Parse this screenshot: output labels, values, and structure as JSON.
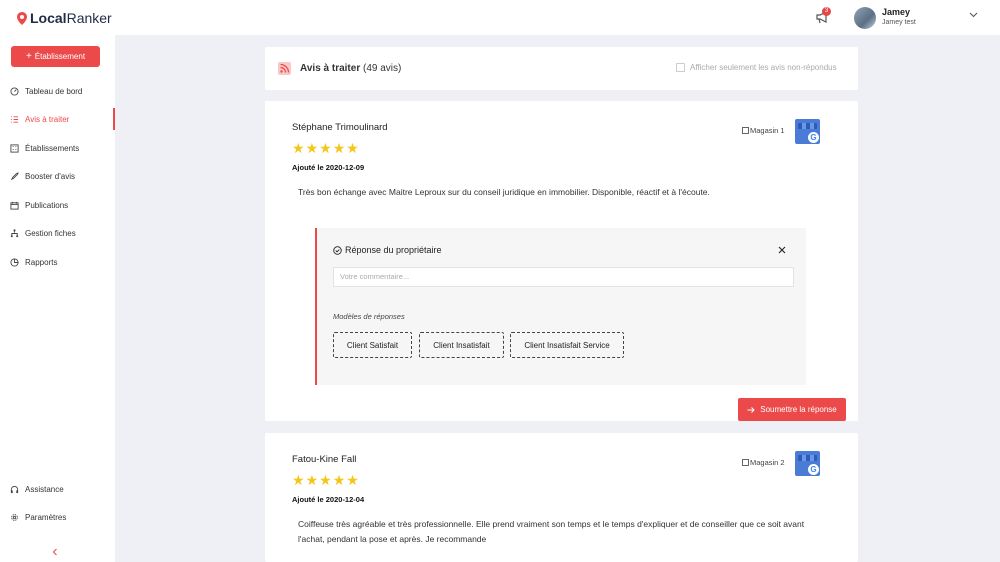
{
  "app": {
    "brand_bold": "Local",
    "brand_light": "Ranker"
  },
  "topbar": {
    "notif_count": "3",
    "user_name": "Jamey",
    "user_sub": "Jamey test"
  },
  "sidebar": {
    "add_label": "Établissement",
    "items": [
      {
        "label": "Tableau de bord",
        "icon": "dashboard-icon"
      },
      {
        "label": "Avis à traiter",
        "icon": "list-icon",
        "active": true
      },
      {
        "label": "Établissements",
        "icon": "building-icon"
      },
      {
        "label": "Booster d'avis",
        "icon": "rocket-icon"
      },
      {
        "label": "Publications",
        "icon": "calendar-icon"
      },
      {
        "label": "Gestion fiches",
        "icon": "sitemap-icon"
      },
      {
        "label": "Rapports",
        "icon": "pie-chart-icon"
      }
    ],
    "bottom_items": [
      {
        "label": "Assistance",
        "icon": "headset-icon"
      },
      {
        "label": "Paramètres",
        "icon": "gear-icon"
      }
    ]
  },
  "header": {
    "title": "Avis à traiter",
    "count": "(49 avis)",
    "filter_label": "Afficher seulement les avis non-répondus"
  },
  "reviews": [
    {
      "author": "Stéphane Trimoulinard",
      "rating": 5,
      "added": "Ajouté le 2020-12-09",
      "store": "Magasin 1",
      "text": "Très bon échange avec Maitre Leproux sur du conseil juridique en immobilier. Disponible, réactif et à l'écoute."
    },
    {
      "author": "Fatou-Kine Fall",
      "rating": 5,
      "added": "Ajouté le 2020-12-04",
      "store": "Magasin 2",
      "text": "Coiffeuse très agréable et très professionnelle. Elle prend vraiment son temps et le temps d'expliquer et de conseiller que ce soit avant l'achat, pendant la pose et après. Je recommande"
    }
  ],
  "reply": {
    "title": "Réponse du propriétaire",
    "placeholder": "Votre commentaire...",
    "templates_label": "Modèles de réponses",
    "templates": [
      "Client Satisfait",
      "Client Insatisfait",
      "Client Insatisfait Service"
    ],
    "submit_label": "Soumettre la réponse"
  },
  "colors": {
    "accent": "#ec4a4a",
    "star": "#f5c518",
    "background": "#eef0f6"
  }
}
